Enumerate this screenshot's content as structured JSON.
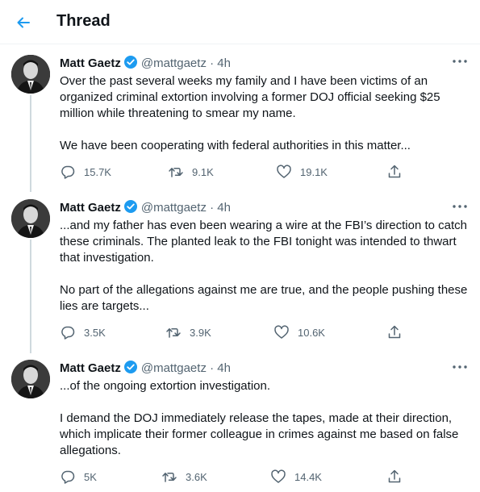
{
  "header": {
    "title": "Thread",
    "back_icon": "arrow-left-icon",
    "accent": "#1d9bf0"
  },
  "tweets": [
    {
      "name": "Matt Gaetz",
      "handle": "@mattgaetz",
      "separator": "·",
      "time": "4h",
      "paragraphs": [
        "Over the past several weeks my family and I have been victims of an organized criminal extortion involving a former DOJ official seeking $25 million while threatening to smear my name.",
        "We have been cooperating with federal authorities in this matter..."
      ],
      "replies": "15.7K",
      "retweets": "9.1K",
      "likes": "19.1K"
    },
    {
      "name": "Matt Gaetz",
      "handle": "@mattgaetz",
      "separator": "·",
      "time": "4h",
      "paragraphs": [
        "...and my father has even been wearing a wire at the FBI’s direction to catch these criminals. The planted leak to the FBI tonight was intended to thwart that investigation.",
        "No part of the allegations against me are true, and the people pushing these lies are targets..."
      ],
      "replies": "3.5K",
      "retweets": "3.9K",
      "likes": "10.6K"
    },
    {
      "name": "Matt Gaetz",
      "handle": "@mattgaetz",
      "separator": "·",
      "time": "4h",
      "paragraphs": [
        "...of the ongoing extortion investigation.",
        "I demand the DOJ immediately release the tapes, made at their direction, which implicate their former colleague in crimes against me based on false allegations."
      ],
      "replies": "5K",
      "retweets": "3.6K",
      "likes": "14.4K"
    }
  ],
  "icons": {
    "reply": "reply-icon",
    "retweet": "retweet-icon",
    "like": "heart-icon",
    "share": "share-icon",
    "more": "more-options-icon",
    "verified": "verified-badge-icon"
  },
  "colors": {
    "text": "#0f1419",
    "secondary": "#536471",
    "verified": "#1d9bf0",
    "thread_line": "#cfd9de"
  }
}
